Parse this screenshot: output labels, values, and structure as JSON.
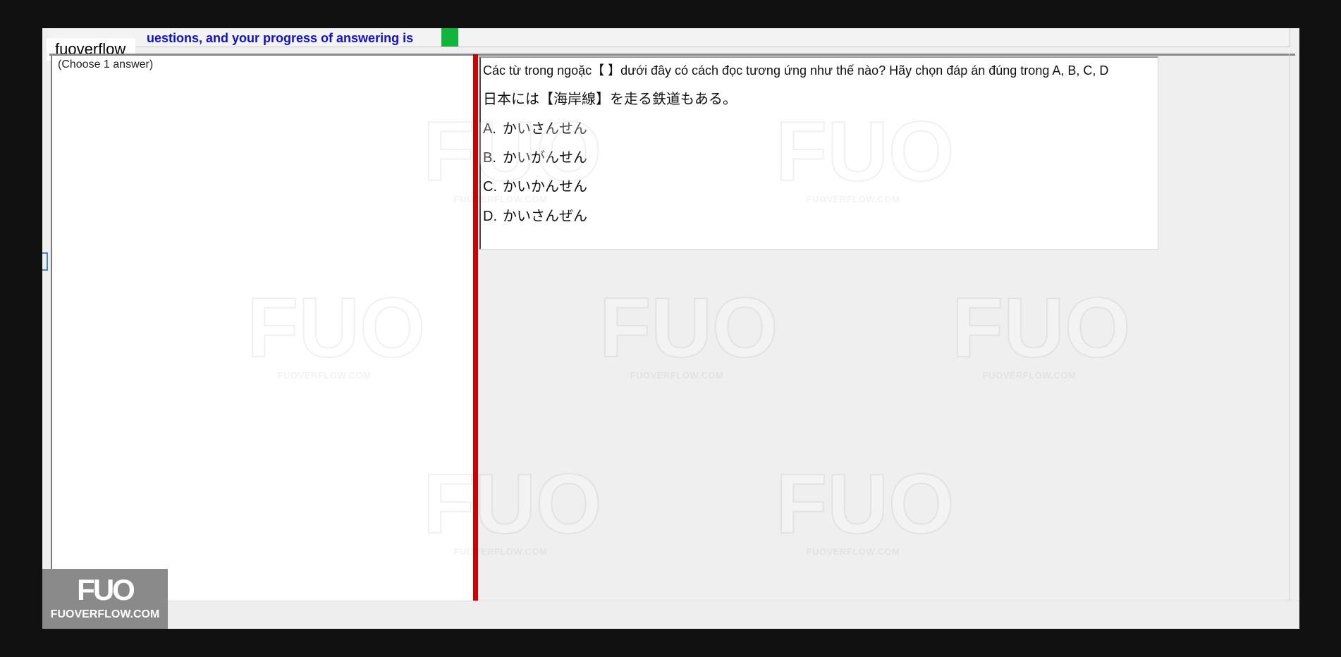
{
  "app": {
    "label": "fuoverflow"
  },
  "progress": {
    "text": "uestions, and your progress of answering is",
    "indicator_color": "#11b53c"
  },
  "left_panel": {
    "hint": "(Choose 1 answer)"
  },
  "question": {
    "prompt": "Các từ trong ngoặc【 】dưới đây có cách đọc tương ứng như thế nào? Hãy chọn đáp án đúng trong A, B, C, D",
    "sentence": "日本には【海岸線】を走る鉄道もある。",
    "options": [
      {
        "letter": "A.",
        "text": "かいさんせん"
      },
      {
        "letter": "B.",
        "text": "かいがんせん"
      },
      {
        "letter": "C.",
        "text": "かいかんせん"
      },
      {
        "letter": "D.",
        "text": "かいさんぜん"
      }
    ]
  },
  "watermark": {
    "logo": "FUO",
    "site": "FUOVERFLOW.COM"
  },
  "badge": {
    "logo": "FUO",
    "site": "FUOVERFLOW.COM"
  },
  "colors": {
    "divider": "#d40000",
    "progress_text": "#1010d0"
  }
}
